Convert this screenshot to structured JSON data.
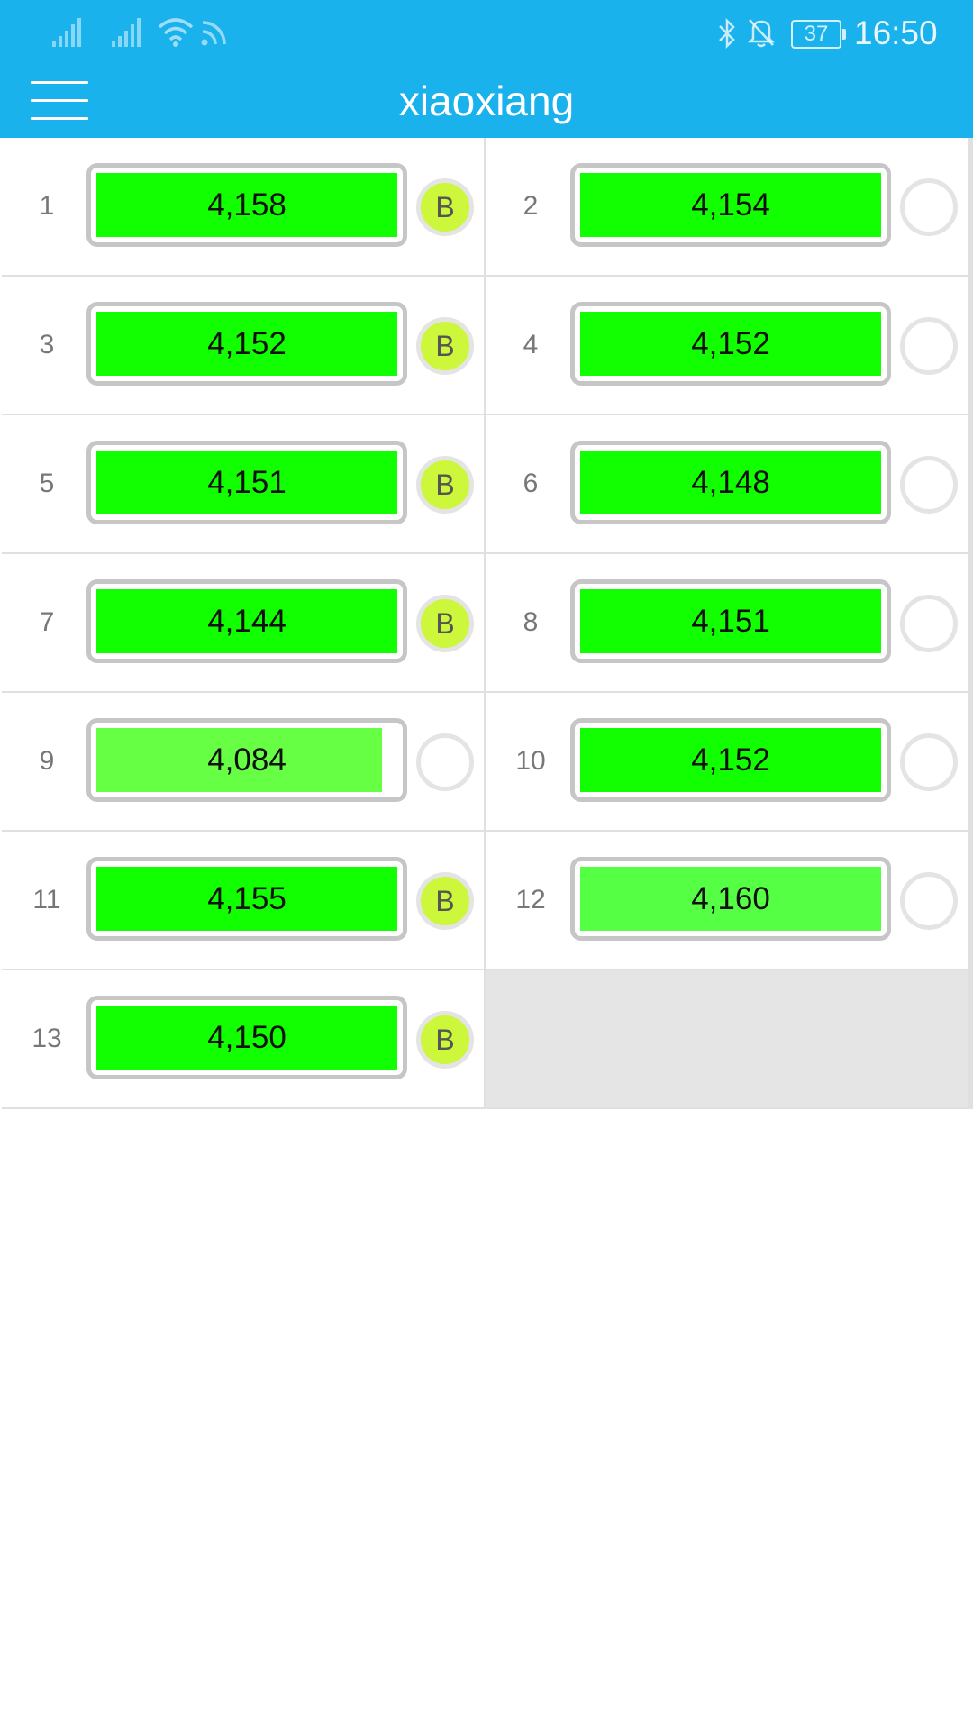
{
  "status_bar": {
    "time": "16:50",
    "battery": "37",
    "icons": [
      "signal-icon",
      "signal-icon",
      "wifi-icon",
      "rss-icon",
      "bluetooth-icon",
      "bell-off-icon",
      "battery-icon"
    ]
  },
  "app_bar": {
    "title": "xiaoxiang",
    "menu_icon": "hamburger-menu-icon"
  },
  "colors": {
    "header": "#1ab2ec",
    "bar_full": "#11ff00",
    "bar_light": "#66ff44",
    "badge_active": "#ccf73a"
  },
  "badge_label": "B",
  "cells": [
    {
      "index": "1",
      "value": "4,158",
      "balancing": true,
      "fill": 1.0,
      "color": "#11ff00"
    },
    {
      "index": "2",
      "value": "4,154",
      "balancing": false,
      "fill": 1.0,
      "color": "#11ff00"
    },
    {
      "index": "3",
      "value": "4,152",
      "balancing": true,
      "fill": 1.0,
      "color": "#11ff00"
    },
    {
      "index": "4",
      "value": "4,152",
      "balancing": false,
      "fill": 1.0,
      "color": "#11ff00"
    },
    {
      "index": "5",
      "value": "4,151",
      "balancing": true,
      "fill": 1.0,
      "color": "#11ff00"
    },
    {
      "index": "6",
      "value": "4,148",
      "balancing": false,
      "fill": 1.0,
      "color": "#11ff00"
    },
    {
      "index": "7",
      "value": "4,144",
      "balancing": true,
      "fill": 1.0,
      "color": "#11ff00"
    },
    {
      "index": "8",
      "value": "4,151",
      "balancing": false,
      "fill": 1.0,
      "color": "#11ff00"
    },
    {
      "index": "9",
      "value": "4,084",
      "balancing": false,
      "fill": 0.95,
      "color": "#66ff44"
    },
    {
      "index": "10",
      "value": "4,152",
      "balancing": false,
      "fill": 1.0,
      "color": "#11ff00"
    },
    {
      "index": "11",
      "value": "4,155",
      "balancing": true,
      "fill": 1.0,
      "color": "#11ff00"
    },
    {
      "index": "12",
      "value": "4,160",
      "balancing": false,
      "fill": 1.0,
      "color": "#55ff44"
    },
    {
      "index": "13",
      "value": "4,150",
      "balancing": true,
      "fill": 1.0,
      "color": "#11ff00"
    }
  ]
}
